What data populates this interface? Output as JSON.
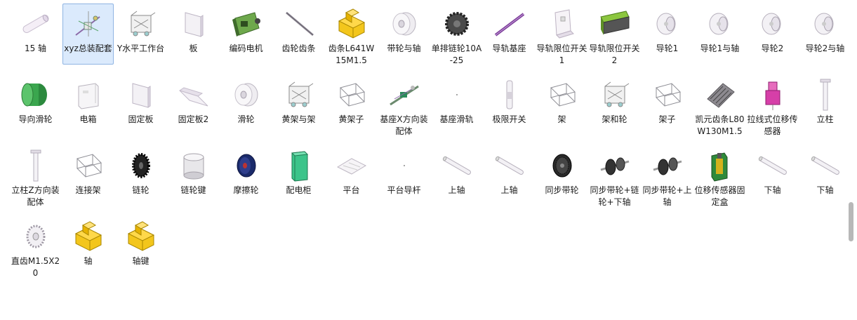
{
  "files": [
    {
      "label": "15 轴",
      "icon": "shaft-part-icon"
    },
    {
      "label": "xyz总装配套",
      "icon": "assembly-icon",
      "selected": true
    },
    {
      "label": "Y水平工作台",
      "icon": "frame-assembly-icon"
    },
    {
      "label": "板",
      "icon": "plate-icon"
    },
    {
      "label": "编码电机",
      "icon": "motor-icon"
    },
    {
      "label": "齿轮齿条",
      "icon": "rod-icon"
    },
    {
      "label": "齿条L641W15M1.5",
      "icon": "generic-part-icon"
    },
    {
      "label": "带轮与轴",
      "icon": "pulley-icon"
    },
    {
      "label": "单排链轮10A-25",
      "icon": "sprocket-icon"
    },
    {
      "label": "导轨基座",
      "icon": "rail-icon"
    },
    {
      "label": "导轨限位开关1",
      "icon": "bracket-icon"
    },
    {
      "label": "导轨限位开关2",
      "icon": "green-bracket-icon"
    },
    {
      "label": "导轮1",
      "icon": "wheel-icon"
    },
    {
      "label": "导轮1与轴",
      "icon": "wheel-icon"
    },
    {
      "label": "导轮2",
      "icon": "wheel-icon"
    },
    {
      "label": "导轮2与轴",
      "icon": "wheel-icon"
    },
    {
      "label": "导向滑轮",
      "icon": "green-roller-icon"
    },
    {
      "label": "电箱",
      "icon": "box-icon"
    },
    {
      "label": "固定板",
      "icon": "plate-icon"
    },
    {
      "label": "固定板2",
      "icon": "angled-plate-icon"
    },
    {
      "label": "滑轮",
      "icon": "pulley-icon"
    },
    {
      "label": "黄架与架",
      "icon": "frame-assembly-icon"
    },
    {
      "label": "黄架子",
      "icon": "frame-icon"
    },
    {
      "label": "基座X方向装配体",
      "icon": "rail-assembly-icon"
    },
    {
      "label": "基座滑轨",
      "icon": "tiny-dot-icon"
    },
    {
      "label": "极限开关",
      "icon": "switch-icon"
    },
    {
      "label": "架",
      "icon": "frame-icon"
    },
    {
      "label": "架和轮",
      "icon": "frame-assembly-icon"
    },
    {
      "label": "架子",
      "icon": "frame-icon"
    },
    {
      "label": "凯元齿条L80W130M1.5",
      "icon": "rack-icon"
    },
    {
      "label": "拉线式位移传感器",
      "icon": "sensor-icon"
    },
    {
      "label": "立柱",
      "icon": "column-icon"
    },
    {
      "label": "立柱Z方向装配体",
      "icon": "column-icon"
    },
    {
      "label": "连接架",
      "icon": "frame-icon"
    },
    {
      "label": "链轮",
      "icon": "black-sprocket-icon"
    },
    {
      "label": "链轮键",
      "icon": "cylinder-icon"
    },
    {
      "label": "摩擦轮",
      "icon": "friction-wheel-icon"
    },
    {
      "label": "配电柜",
      "icon": "cabinet-icon"
    },
    {
      "label": "平台",
      "icon": "platform-icon"
    },
    {
      "label": "平台导杆",
      "icon": "tiny-dot-icon"
    },
    {
      "label": "上轴",
      "icon": "shaft-icon"
    },
    {
      "label": "上轴",
      "icon": "shaft-icon"
    },
    {
      "label": "同步带轮",
      "icon": "timing-pulley-icon"
    },
    {
      "label": "同步带轮+链轮+下轴",
      "icon": "pulley-assembly-icon"
    },
    {
      "label": "同步带轮+上轴",
      "icon": "pulley-assembly-icon"
    },
    {
      "label": "位移传感器固定盒",
      "icon": "green-box-icon"
    },
    {
      "label": "下轴",
      "icon": "shaft-icon"
    },
    {
      "label": "下轴",
      "icon": "shaft-icon"
    },
    {
      "label": "直齿M1.5X20",
      "icon": "spur-gear-icon"
    },
    {
      "label": "轴",
      "icon": "generic-part-icon"
    },
    {
      "label": "轴键",
      "icon": "generic-part-icon"
    }
  ]
}
